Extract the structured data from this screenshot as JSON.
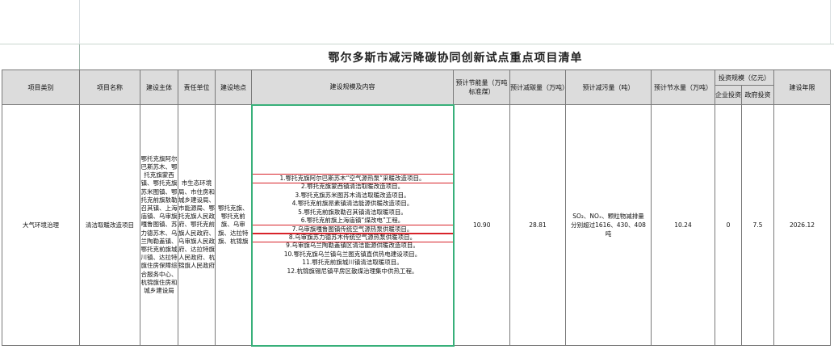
{
  "title": "鄂尔多斯市减污降碳协同创新试点重点项目清单",
  "headers": {
    "category": "项目类别",
    "name": "项目名称",
    "subject": "建设主体",
    "unit": "责任单位",
    "location": "建设地点",
    "scope": "建设规模及内容",
    "energy_saving": "预计节能量（万吨标准煤）",
    "carbon_reduction": "预计减碳量（万吨）",
    "pollution_reduction": "预计减污量（吨）",
    "water_saving": "预计节水量（万吨）",
    "investment": "投资规模（亿元）",
    "enterprise_investment": "企业投资",
    "government_investment": "政府投资",
    "year": "建设年限"
  },
  "row": {
    "category": "大气环境治理",
    "name": "清洁取暖改造项目",
    "subject": "鄂托克旗阿尔巴斯苏木、鄂托克旗蒙西镇、鄂托克旗苏米图镇、鄂托克前旗敖勒召其镇、上海庙镇、乌审旗嘎鲁图镇、苏力德苏木、乌兰陶勒盖镇、鄂托克前旗城川镇、达拉特旗住房保障综合服务中心、杭锦旗住房和城乡建设局",
    "unit": "市生态环境局、市住房和城乡建设局、市能源局、鄂托克旗人民政府、鄂托克前旗人民政府、乌审旗人民政府、达拉特旗人民政府、杭锦旗人民政府",
    "location": "鄂托克旗、鄂托克前旗、乌审旗、达拉特旗、杭锦旗",
    "scope_items": [
      "1.鄂托克旗阿尔巴斯苏木“空气源热泵”采暖改造项目。",
      "2.鄂托克旗蒙西镇清洁取暖改造项目。",
      "3.鄂托克旗苏米图苏木清洁取暖改造项目。",
      "4.鄂托克前旗昂素镇清洁能源供暖改造项目。",
      "5.鄂托克前旗敖勒召其镇清洁取暖项目。",
      "6.鄂托克前旗上海庙镇“煤改电”工程。",
      "7.乌审旗嘎鲁图镇传统空气源热泵供暖项目。",
      "8.乌审旗苏力德苏木传统空气源热泵供暖项目。",
      "9.乌审旗乌兰陶勒盖镇区清洁能源供暖改造项目。",
      "10.鄂托克旗乌兰镇乌兰图克镇直供热电建设项目。",
      "11.鄂托克前旗城川镇清洁取暖项目。",
      "12.杭锦旗锡尼镇平房区散煤治理集中供热工程。"
    ],
    "energy_saving": "10.90",
    "carbon_reduction": "28.81",
    "pollution_reduction": "SO₂、NOₓ、颗粒物减排量分别超过1616、430、408吨",
    "water_saving": "10.24",
    "enterprise_investment": "0",
    "government_investment": "7.5",
    "year": "2026.12"
  },
  "highlight_color": "#d8232a",
  "content_border_color": "#38b07a"
}
